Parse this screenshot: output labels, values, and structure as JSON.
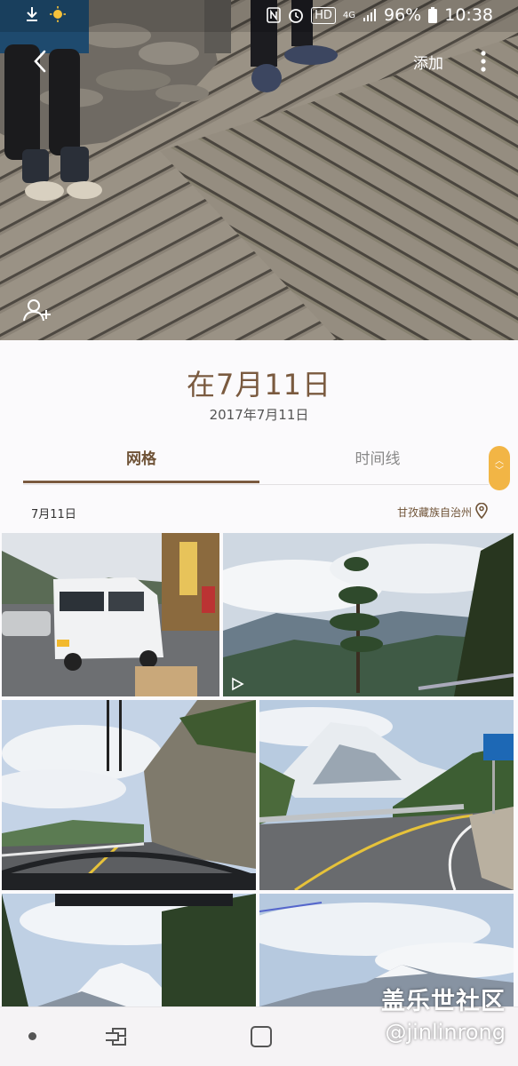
{
  "status": {
    "time": "10:38",
    "battery": "96%",
    "network": "4G",
    "hd": "HD",
    "left_icons": [
      "download-icon",
      "weather-sun-icon"
    ],
    "right_icons": [
      "nfc-icon",
      "alarm-icon",
      "hd-icon",
      "signal-icon",
      "battery-icon"
    ]
  },
  "header": {
    "back_icon": "chevron-left-icon",
    "add_label": "添加",
    "more_icon": "more-vertical-icon",
    "tag_people_icon": "person-add-icon"
  },
  "album": {
    "title": "在7月11日",
    "date": "2017年7月11日"
  },
  "tabs": [
    {
      "label": "网格",
      "active": true
    },
    {
      "label": "时间线",
      "active": false
    }
  ],
  "group": {
    "date": "7月11日",
    "location": "甘孜藏族自治州",
    "location_icon": "location-pin-icon"
  },
  "photos": [
    {
      "subject": "white van on street",
      "type": "image"
    },
    {
      "subject": "mountain valley with pine tree",
      "type": "video"
    },
    {
      "subject": "road along cliff",
      "type": "image"
    },
    {
      "subject": "snow mountain and curved road",
      "type": "image"
    },
    {
      "subject": "snow peak behind trees",
      "type": "image"
    },
    {
      "subject": "snow peak and clouds",
      "type": "image"
    }
  ],
  "navbar": {
    "icons": [
      "dot-icon",
      "recent-apps-icon",
      "home-icon",
      "back-nav-icon"
    ]
  },
  "watermark": {
    "line1": "盖乐世社区",
    "line2": "@jinlinrong"
  },
  "colors": {
    "accent": "#7a5a3f",
    "scroll_handle": "#f2b545"
  }
}
